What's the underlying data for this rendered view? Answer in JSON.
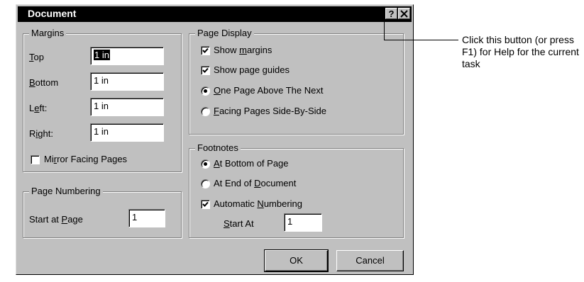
{
  "dialog": {
    "title": "Document",
    "help_button": "?",
    "close_button": "✕"
  },
  "margins": {
    "legend": "Margins",
    "top": {
      "label_u": "T",
      "label_rest": "op",
      "value": "1 in"
    },
    "bottom": {
      "label_u": "B",
      "label_rest": "ottom",
      "value": "1 in"
    },
    "left": {
      "label_pre": "L",
      "label_u": "e",
      "label_rest": "ft:",
      "value": "1 in"
    },
    "right": {
      "label_pre": "R",
      "label_u": "i",
      "label_rest": "ght:",
      "value": "1 in"
    },
    "mirror": {
      "label_pre": "Mi",
      "label_u": "r",
      "label_rest": "ror Facing Pages",
      "checked": false
    }
  },
  "page_numbering": {
    "legend": "Page Numbering",
    "start_label_pre": "Start at ",
    "start_label_u": "P",
    "start_label_rest": "age",
    "start_value": "1"
  },
  "page_display": {
    "legend": "Page Display",
    "show_margins": {
      "label_pre": "Show ",
      "label_u": "m",
      "label_rest": "argins",
      "checked": true
    },
    "show_guides": {
      "label_pre": "Show pa",
      "label_u": "g",
      "label_rest": "e guides",
      "checked": true
    },
    "one_page": {
      "label_u": "O",
      "label_rest": "ne Page Above The Next",
      "selected": true
    },
    "facing": {
      "label_u": "F",
      "label_rest": "acing Pages Side-By-Side",
      "selected": false
    }
  },
  "footnotes": {
    "legend": "Footnotes",
    "at_bottom": {
      "label_u": "A",
      "label_rest": "t Bottom of Page",
      "selected": true
    },
    "at_end": {
      "label_pre": "At End of ",
      "label_u": "D",
      "label_rest": "ocument",
      "selected": false
    },
    "auto_numbering": {
      "label_pre": "Automatic ",
      "label_u": "N",
      "label_rest": "umbering",
      "checked": true
    },
    "start_at": {
      "label_u": "S",
      "label_rest": "tart At",
      "value": "1"
    }
  },
  "buttons": {
    "ok": "OK",
    "cancel": "Cancel"
  },
  "callout": {
    "text": "Click this button (or press F1) for Help for the current task"
  }
}
